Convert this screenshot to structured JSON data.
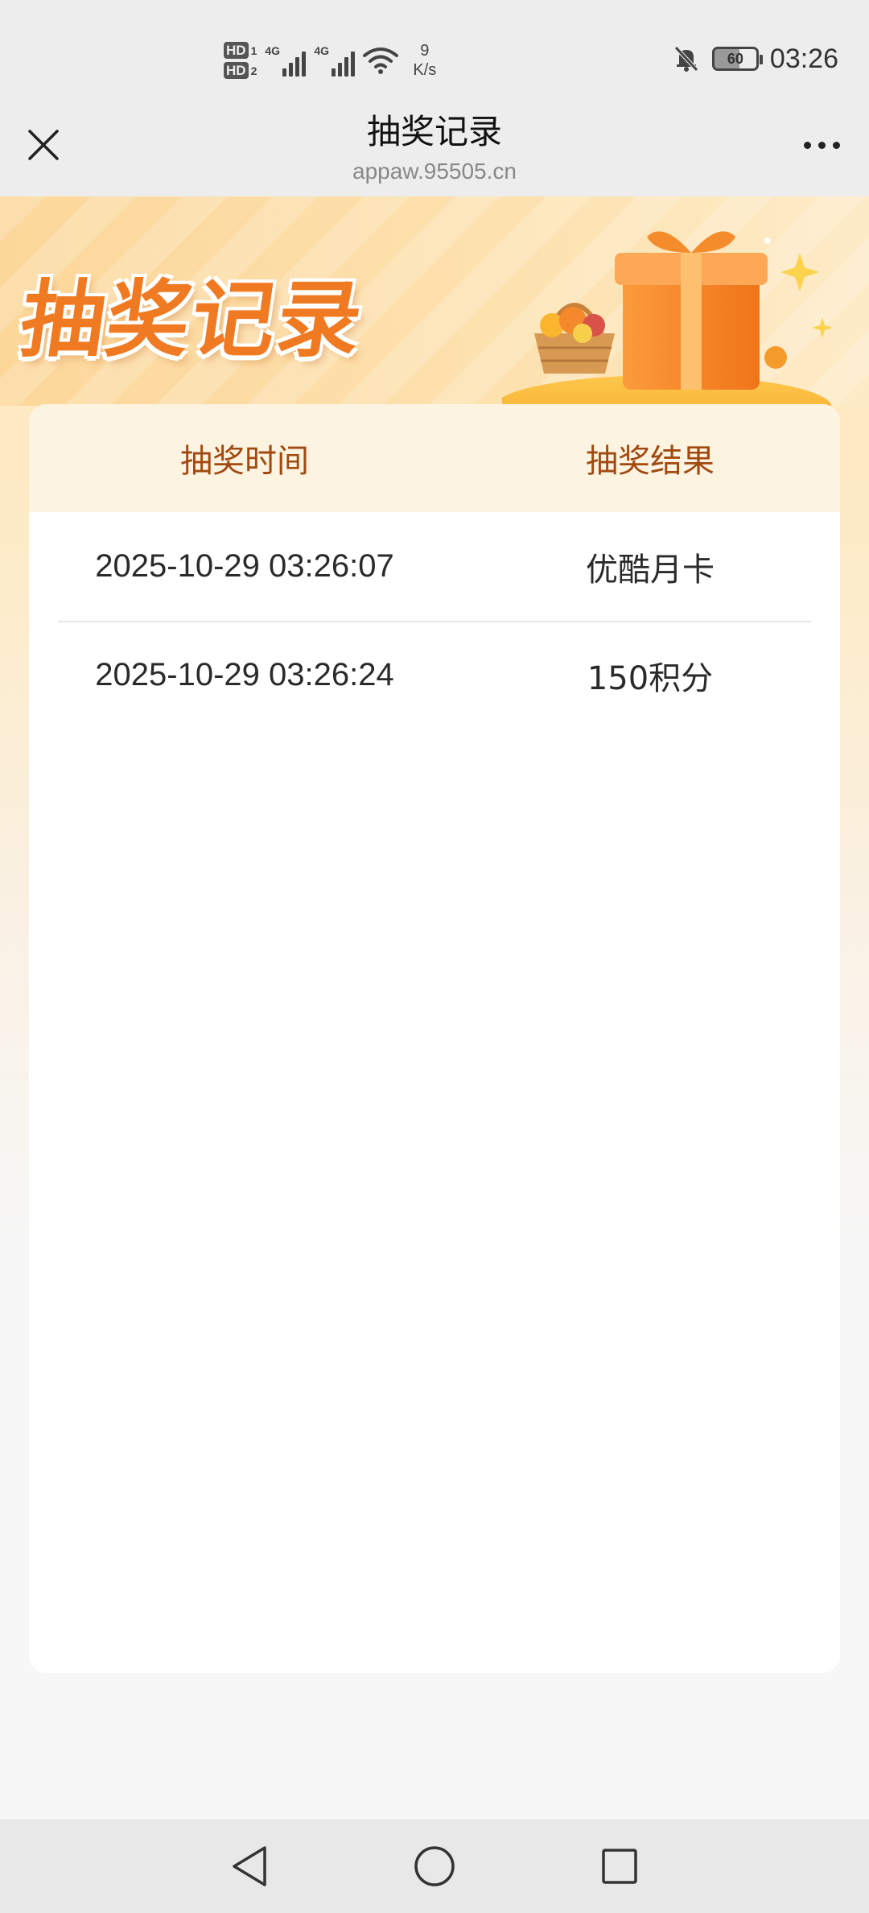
{
  "status_bar": {
    "sim1": "HD",
    "sim1_index": "1",
    "sim2": "HD",
    "sim2_index": "2",
    "net1": "4G",
    "net2": "4G",
    "speed_value": "9",
    "speed_unit": "K/s",
    "battery": "60",
    "time": "03:26"
  },
  "titlebar": {
    "title": "抽奖记录",
    "url": "appaw.95505.cn"
  },
  "hero": {
    "title": "抽奖记录"
  },
  "table": {
    "headers": [
      "抽奖时间",
      "抽奖结果"
    ],
    "rows": [
      {
        "time": "2025-10-29 03:26:07",
        "result": "优酷月卡"
      },
      {
        "time": "2025-10-29 03:26:24",
        "result": "150积分"
      }
    ]
  },
  "colors": {
    "accent": "#f07a21",
    "header_text": "#a14a10",
    "header_bg": "#fdf3e1"
  }
}
